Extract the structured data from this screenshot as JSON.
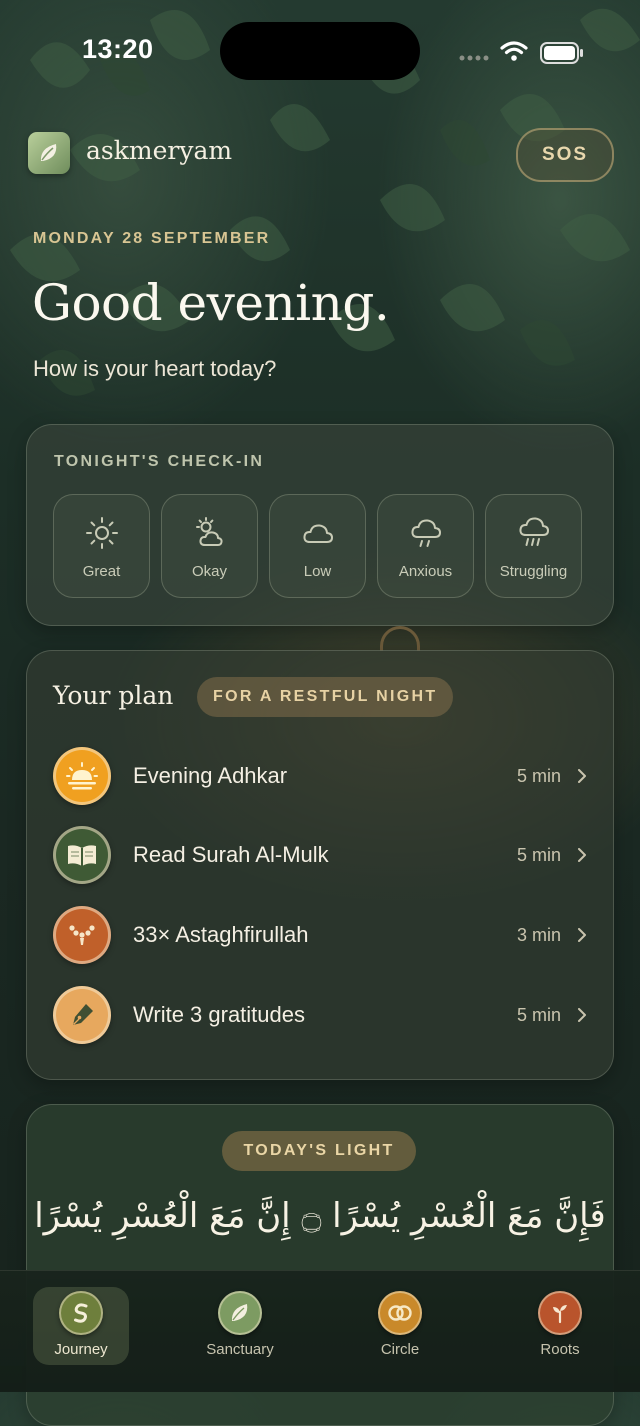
{
  "status_bar": {
    "time": "13:20"
  },
  "header": {
    "app_name": "askmeryam",
    "sos_label": "SOS"
  },
  "greeting": {
    "date": "MONDAY 28 SEPTEMBER",
    "title": "Good evening.",
    "subtitle": "How is your heart today?"
  },
  "checkin": {
    "title": "TONIGHT'S CHECK-IN",
    "moods": [
      {
        "label": "Great",
        "icon": "sun-icon"
      },
      {
        "label": "Okay",
        "icon": "partly-cloudy-icon"
      },
      {
        "label": "Low",
        "icon": "cloud-icon"
      },
      {
        "label": "Anxious",
        "icon": "light-rain-icon"
      },
      {
        "label": "Struggling",
        "icon": "heavy-rain-icon"
      }
    ]
  },
  "plan": {
    "title": "Your plan",
    "badge": "FOR A RESTFUL NIGHT",
    "items": [
      {
        "label": "Evening Adhkar",
        "duration": "5 min",
        "icon": "sunset-icon",
        "color": "#f0a020"
      },
      {
        "label": "Read Surah Al-Mulk",
        "duration": "5 min",
        "icon": "open-book-icon",
        "color": "#3f5a35"
      },
      {
        "label": "33× Astaghfirullah",
        "duration": "3 min",
        "icon": "prayer-beads-icon",
        "color": "#c0602a"
      },
      {
        "label": "Write 3 gratitudes",
        "duration": "5 min",
        "icon": "pen-nib-icon",
        "color": "#e7a85e"
      }
    ]
  },
  "light": {
    "badge": "TODAY'S LIGHT",
    "verse": "فَإِنَّ مَعَ الْعُسْرِ يُسْرًا ۝ إِنَّ مَعَ الْعُسْرِ يُسْرًا"
  },
  "tabbar": {
    "tabs": [
      {
        "label": "Journey",
        "icon": "journey-icon",
        "active": true
      },
      {
        "label": "Sanctuary",
        "icon": "leaf-icon",
        "active": false
      },
      {
        "label": "Circle",
        "icon": "rings-icon",
        "active": false
      },
      {
        "label": "Roots",
        "icon": "sprout-icon",
        "active": false
      }
    ]
  }
}
